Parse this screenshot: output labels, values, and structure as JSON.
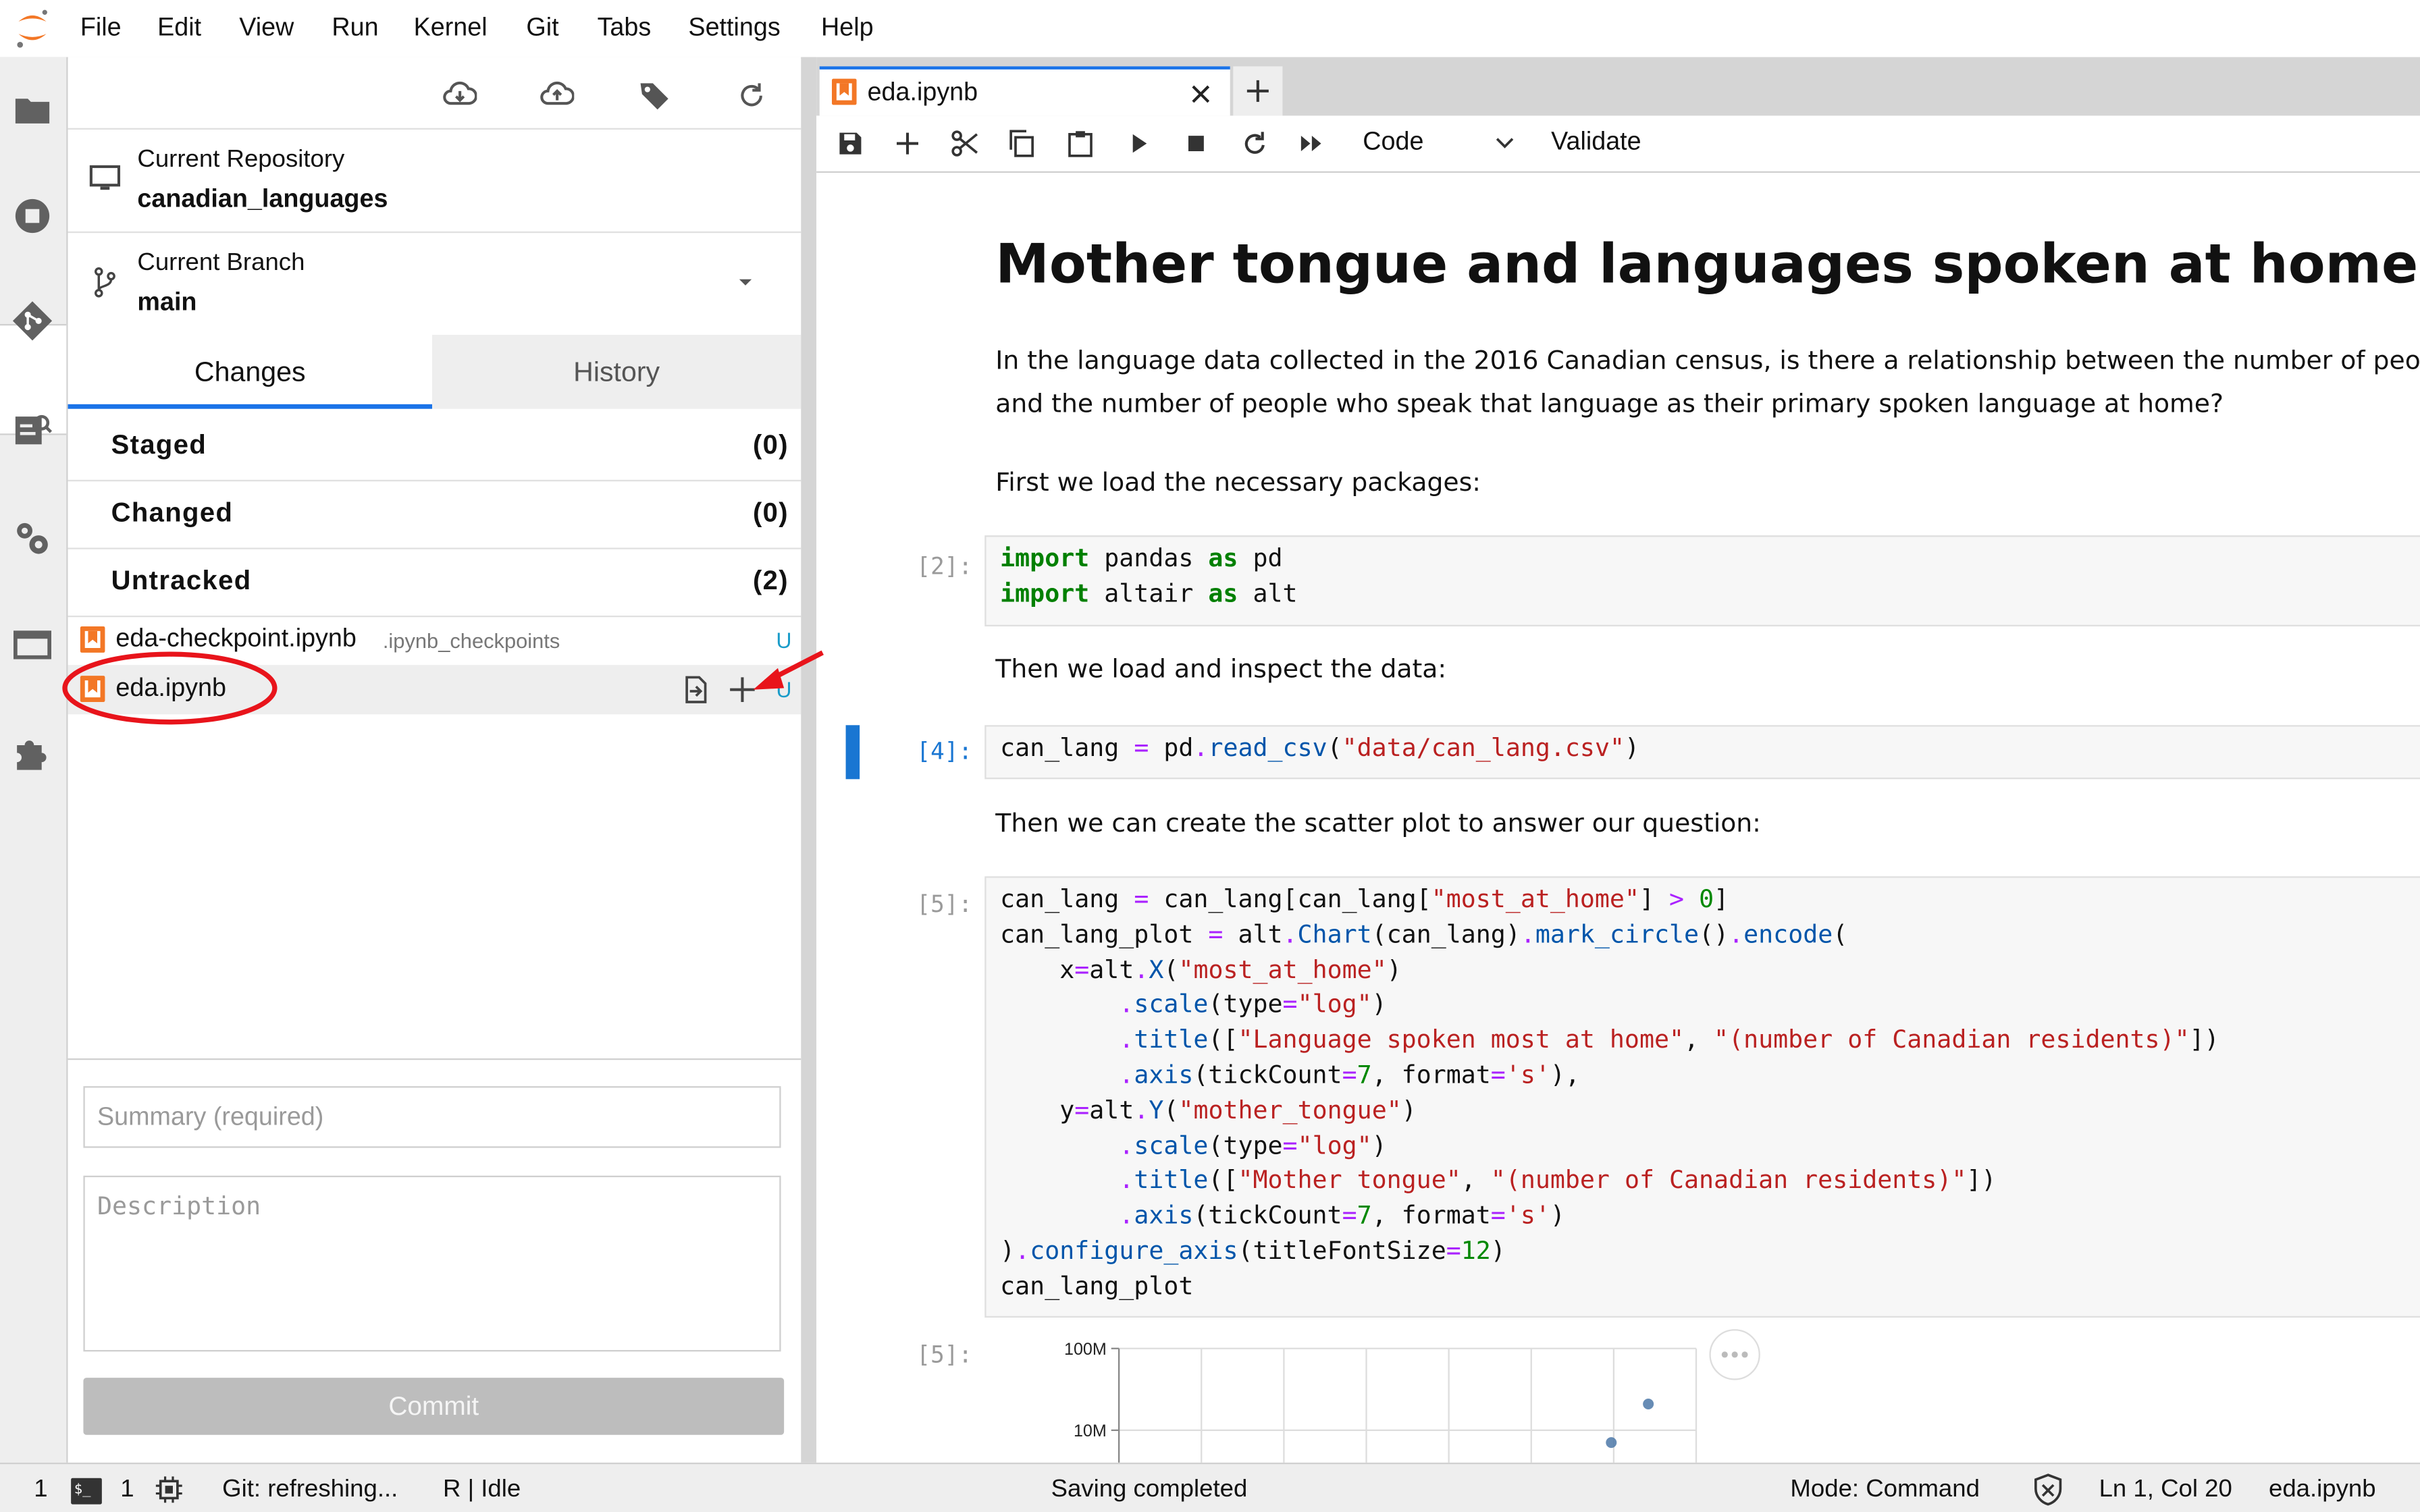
{
  "menu": [
    "File",
    "Edit",
    "View",
    "Run",
    "Kernel",
    "Git",
    "Tabs",
    "Settings",
    "Help"
  ],
  "activity_icons": [
    "folder-icon",
    "running-icon",
    "git-icon",
    "property-inspector-icon",
    "settings-icon",
    "tabs-icon",
    "extension-icon"
  ],
  "git": {
    "toolbar_icons": [
      "cloud-pull-icon",
      "cloud-push-icon",
      "tag-icon",
      "refresh-icon"
    ],
    "repo_label": "Current Repository",
    "repo_name": "canadian_languages",
    "branch_label": "Current Branch",
    "branch_name": "main",
    "tabs": [
      "Changes",
      "History"
    ],
    "staged": {
      "label": "Staged",
      "count": "(0)"
    },
    "changed": {
      "label": "Changed",
      "count": "(0)"
    },
    "untracked": {
      "label": "Untracked",
      "count": "(2)"
    },
    "files": [
      {
        "name": "eda-checkpoint.ipynb",
        "path": ".ipynb_checkpoints",
        "status": "U"
      },
      {
        "name": "eda.ipynb",
        "path": "",
        "status": "U"
      }
    ],
    "summary_placeholder": "Summary (required)",
    "description_placeholder": "Description",
    "commit_label": "Commit"
  },
  "annotation_color": "#e8141b",
  "notebook": {
    "tab_title": "eda.ipynb",
    "cell_type": "Code",
    "validate_label": "Validate",
    "heading": "Mother tongue and languages spoken at home in Canada",
    "para1_line1": "In the language data collected in the 2016 Canadian census, is there a relationship between the number of people who",
    "para1_line2": "and the number of people who speak that language as their primary spoken language at home?",
    "para2": "First we load the necessary packages:",
    "prompt1": "[2]:",
    "para3": "Then we load and inspect the data:",
    "prompt2": "[4]:",
    "para4": "Then we can create the scatter plot to answer our question:",
    "prompt3": "[5]:",
    "prompt4": "[5]:",
    "chart_ticks": [
      "100M",
      "10M"
    ]
  },
  "status": {
    "count1": "1",
    "count2": "1",
    "git": "Git: refreshing...",
    "kernel": "R | Idle",
    "saving": "Saving completed",
    "mode": "Mode: Command",
    "position": "Ln 1, Col 20",
    "file": "eda.ipynb"
  },
  "chart_data": {
    "type": "scatter",
    "yscale": "log",
    "yticks": [
      "100M",
      "10M"
    ],
    "points_visible": 2
  }
}
